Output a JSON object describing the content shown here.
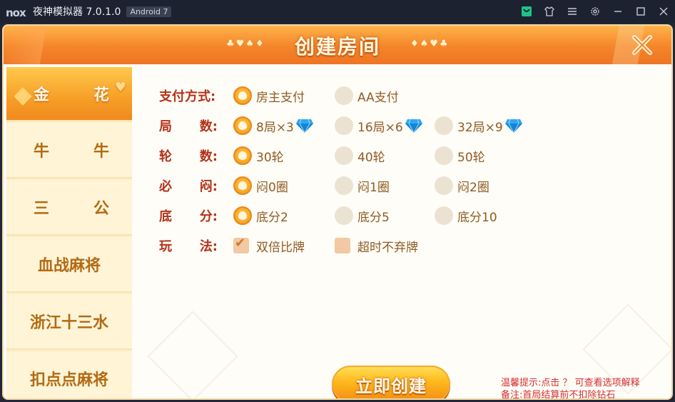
{
  "titlebar": {
    "logo": "nox",
    "app_name": "夜神模拟器 7.0.1.0",
    "android_badge": "Android 7",
    "icons": [
      "store-icon",
      "shirt-icon",
      "menu-icon",
      "settings-icon",
      "minimize-icon",
      "maximize-icon",
      "close-icon"
    ]
  },
  "header": {
    "title": "创建房间",
    "suits_left": "♣♥♠♦",
    "suits_right": "♦♠♥♣"
  },
  "sidebar": {
    "items": [
      {
        "label_a": "金",
        "label_b": "花",
        "active": true
      },
      {
        "label_a": "牛",
        "label_b": "牛",
        "active": false
      },
      {
        "label_a": "三",
        "label_b": "公",
        "active": false
      },
      {
        "label": "血战麻将",
        "active": false
      },
      {
        "label": "浙江十三水",
        "active": false
      },
      {
        "label": "扣点点麻将",
        "active": false
      }
    ]
  },
  "settings": {
    "payment": {
      "label_a": "支付方式:",
      "options": [
        "房主支付",
        "AA支付"
      ],
      "selected": 0
    },
    "rounds": {
      "label_a": "局",
      "label_b": "数:",
      "options": [
        "8局×3",
        "16局×6",
        "32局×9"
      ],
      "selected": 0
    },
    "turns": {
      "label_a": "轮",
      "label_b": "数:",
      "options": [
        "30轮",
        "40轮",
        "50轮"
      ],
      "selected": 0
    },
    "blind": {
      "label_a": "必",
      "label_b": "闷:",
      "options": [
        "闷0圈",
        "闷1圈",
        "闷2圈"
      ],
      "selected": 0
    },
    "base": {
      "label_a": "底",
      "label_b": "分:",
      "options": [
        "底分2",
        "底分5",
        "底分10"
      ],
      "selected": 0
    },
    "rules": {
      "label_a": "玩",
      "label_b": "法:",
      "options": [
        "双倍比牌",
        "超时不弃牌"
      ],
      "checked": [
        true,
        false
      ]
    }
  },
  "create_button": "立即创建",
  "tips": {
    "line1": "温馨提示:点击 ？ 可查看选项解释",
    "line2": "备注:首局结算前不扣除钻石"
  },
  "colors": {
    "accent_orange": "#f4852a",
    "label_red": "#b2321a",
    "option_text": "#8e5a22",
    "tip_red": "#d12f2f"
  }
}
